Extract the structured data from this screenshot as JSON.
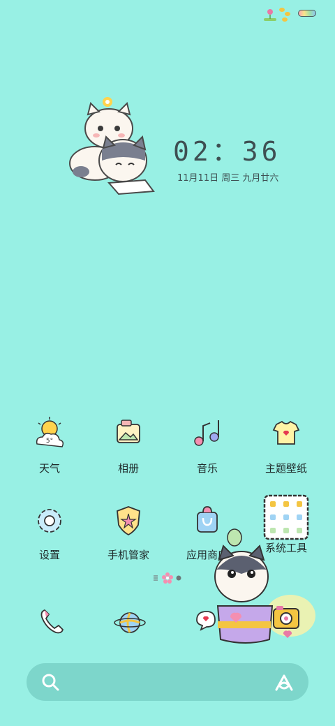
{
  "status_bar": {
    "decoration_icon": "bees-flower-icon",
    "battery_icon": "rainbow-battery-icon"
  },
  "lockscreen": {
    "time": "02：36",
    "date": "11月11日 周三 九月廿六"
  },
  "widget": {
    "sticker": "two-cats-sticker"
  },
  "apps_row1": [
    {
      "label": "天气",
      "icon": "weather-icon",
      "temp": "5°"
    },
    {
      "label": "相册",
      "icon": "gallery-icon"
    },
    {
      "label": "音乐",
      "icon": "music-icon"
    },
    {
      "label": "主题壁纸",
      "icon": "theme-wallpaper-icon"
    }
  ],
  "apps_row2": [
    {
      "label": "设置",
      "icon": "settings-icon"
    },
    {
      "label": "手机管家",
      "icon": "phone-manager-icon"
    },
    {
      "label": "应用商店",
      "icon": "app-store-icon"
    },
    {
      "label": "系统工具",
      "icon": "system-tools-folder-icon"
    }
  ],
  "page_indicator": {
    "pages": 3,
    "current": 2
  },
  "dock": [
    {
      "icon": "phone-icon"
    },
    {
      "icon": "browser-icon"
    },
    {
      "icon": "messages-icon"
    },
    {
      "icon": "camera-icon"
    }
  ],
  "search_bar": {
    "search_icon": "search-icon",
    "assistant_icon": "assistant-icon"
  }
}
